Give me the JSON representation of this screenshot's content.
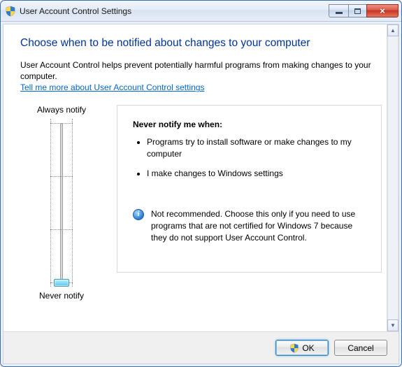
{
  "window": {
    "title": "User Account Control Settings"
  },
  "heading": "Choose when to be notified about changes to your computer",
  "intro": "User Account Control helps prevent potentially harmful programs from making changes to your computer.",
  "help_link": "Tell me more about User Account Control settings",
  "slider": {
    "top_label": "Always notify",
    "bottom_label": "Never notify",
    "level_count": 4,
    "current_level": 0
  },
  "description": {
    "title": "Never notify me when:",
    "bullets": [
      "Programs try to install software or make changes to my computer",
      "I make changes to Windows settings"
    ],
    "recommendation": "Not recommended. Choose this only if you need to use programs that are not certified for Windows 7 because they do not support User Account Control."
  },
  "buttons": {
    "ok": "OK",
    "cancel": "Cancel"
  }
}
